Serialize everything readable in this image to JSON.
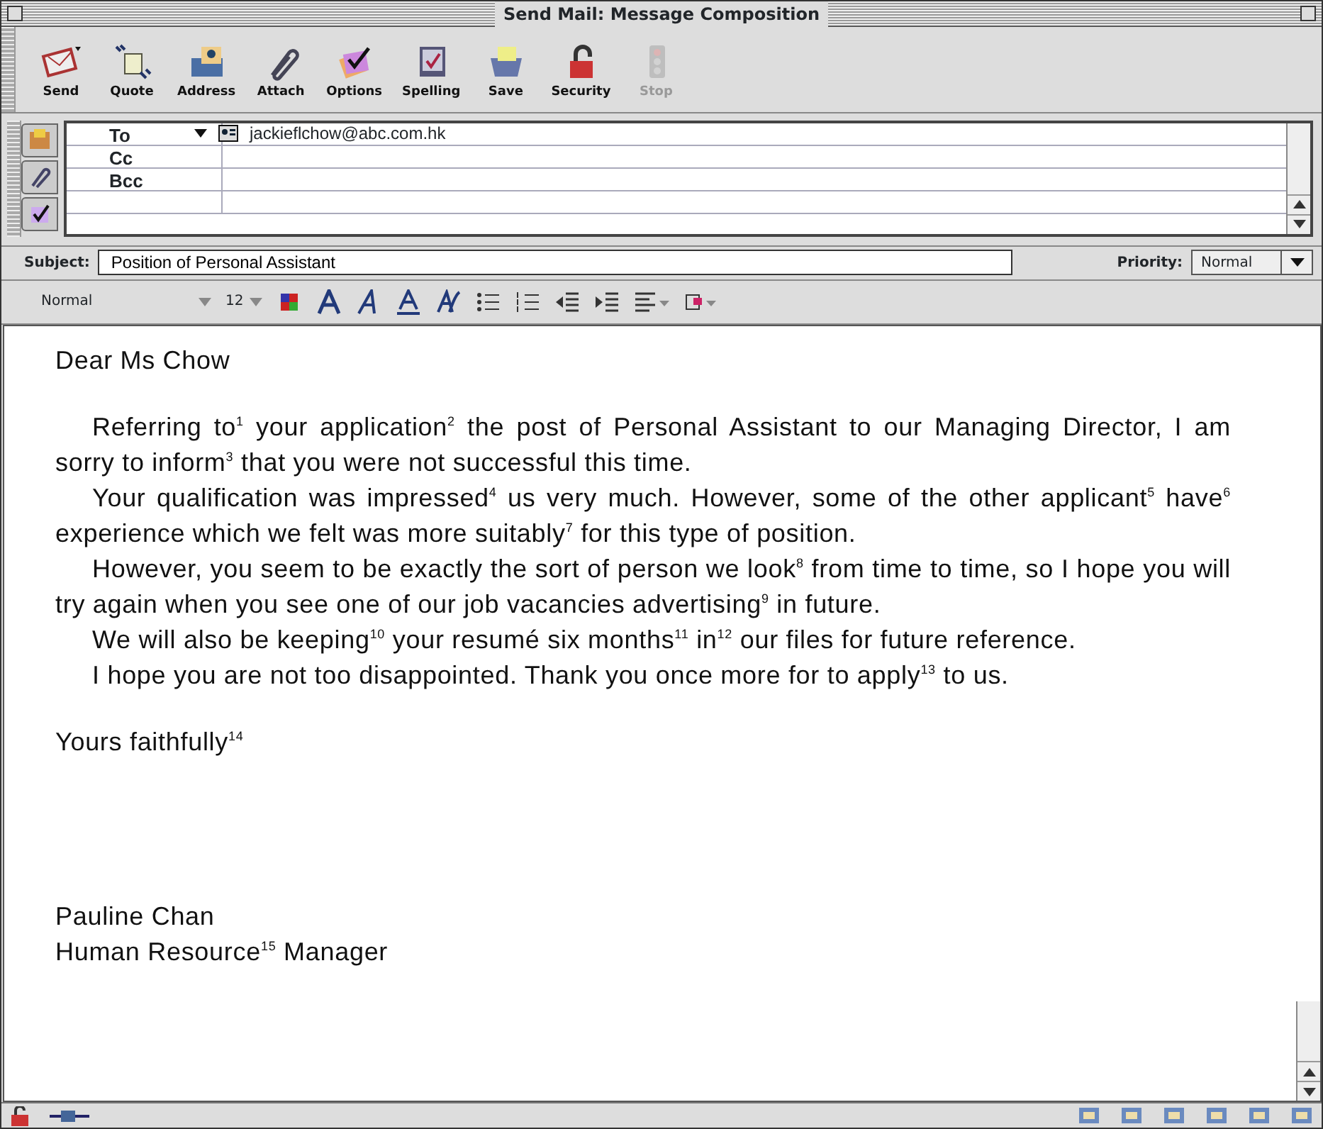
{
  "window": {
    "title": "Send Mail: Message Composition"
  },
  "toolbar": [
    {
      "label": "Send",
      "disabled": false
    },
    {
      "label": "Quote",
      "disabled": false
    },
    {
      "label": "Address",
      "disabled": false
    },
    {
      "label": "Attach",
      "disabled": false
    },
    {
      "label": "Options",
      "disabled": false
    },
    {
      "label": "Spelling",
      "disabled": false
    },
    {
      "label": "Save",
      "disabled": false
    },
    {
      "label": "Security",
      "disabled": false
    },
    {
      "label": "Stop",
      "disabled": true
    }
  ],
  "recipients": [
    {
      "type": "To",
      "address": "jackieflchow@abc.com.hk"
    },
    {
      "type": "Cc"
    },
    {
      "type": "Bcc"
    }
  ],
  "subject": {
    "label": "Subject:",
    "value": "Position of Personal Assistant"
  },
  "priority": {
    "label": "Priority:",
    "value": "Normal"
  },
  "format": {
    "style": "Normal",
    "size": "12"
  },
  "message": {
    "greeting": "Dear Ms Chow",
    "paragraphs": [
      "Referring to$^{1}$ your application$^{2}$ the post of Personal Assistant to our Managing Director, I am sorry to inform$^{3}$ that you were not successful this time.",
      "Your qualification was impressed$^{4}$ us very much. However, some of the other applicant$^{5}$ have$^{6}$ experience which we felt was more suitably$^{7}$ for this type of position.",
      "However, you seem to be exactly the sort of person we look$^{8}$ from time to time, so I hope you will try again when you see one of our job vacancies advertising$^{9}$ in future.",
      "We will also be keeping$^{10}$ your resumé six months$^{11}$ in$^{12}$ our files for future reference.",
      "I hope you are not too disappointed. Thank you once more for to apply$^{13}$ to us."
    ],
    "closing": "Yours faithfully$^{14}$",
    "signature": [
      "Pauline Chan",
      "Human Resource$^{15}$ Manager"
    ]
  }
}
